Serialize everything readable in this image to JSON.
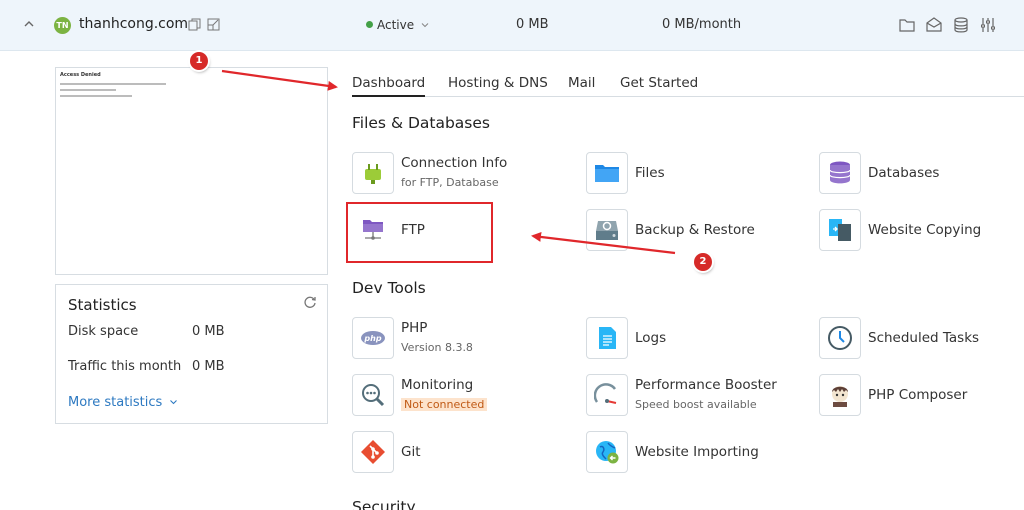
{
  "topbar": {
    "logo_text": "TN",
    "domain": "thanhcong.com",
    "status": "Active",
    "disk": "0 MB",
    "traffic": "0 MB/month"
  },
  "thumbnail": {
    "title": "Access Denied"
  },
  "statistics": {
    "title": "Statistics",
    "disk_label": "Disk space",
    "disk_value": "0 MB",
    "traffic_label": "Traffic this month",
    "traffic_value": "0 MB",
    "more": "More statistics"
  },
  "tabs": [
    "Dashboard",
    "Hosting & DNS",
    "Mail",
    "Get Started"
  ],
  "sections": {
    "files": "Files & Databases",
    "dev": "Dev Tools",
    "security": "Security"
  },
  "items": {
    "connection_info": {
      "label": "Connection Info",
      "sub": "for FTP, Database"
    },
    "files": {
      "label": "Files"
    },
    "databases": {
      "label": "Databases"
    },
    "ftp": {
      "label": "FTP"
    },
    "backup": {
      "label": "Backup & Restore"
    },
    "website_copying": {
      "label": "Website Copying"
    },
    "php": {
      "label": "PHP",
      "sub": "Version 8.3.8"
    },
    "logs": {
      "label": "Logs"
    },
    "scheduled_tasks": {
      "label": "Scheduled Tasks"
    },
    "monitoring": {
      "label": "Monitoring",
      "badge": "Not connected"
    },
    "performance": {
      "label": "Performance Booster",
      "sub": "Speed boost available"
    },
    "php_composer": {
      "label": "PHP Composer"
    },
    "git": {
      "label": "Git"
    },
    "website_importing": {
      "label": "Website Importing"
    }
  },
  "annotations": {
    "step1": "1",
    "step2": "2"
  },
  "colors": {
    "accent": "#2d79c1",
    "annotation_red": "#e0272b",
    "active_green": "#43a047"
  }
}
